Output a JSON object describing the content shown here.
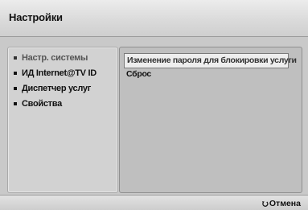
{
  "window": {
    "title": "Настройки"
  },
  "menu": {
    "items": [
      {
        "label": "Настр. системы",
        "active": true
      },
      {
        "label": "ИД Internet@TV ID",
        "active": false
      },
      {
        "label": "Диспетчер услуг",
        "active": false
      },
      {
        "label": "Свойства",
        "active": false
      }
    ]
  },
  "content": {
    "items": [
      {
        "label": "Изменение пароля для блокировки услуги",
        "selected": true
      },
      {
        "label": "Сброс",
        "selected": false
      }
    ]
  },
  "footer": {
    "cancel_label": "Отмена",
    "cancel_icon": "return-icon"
  }
}
